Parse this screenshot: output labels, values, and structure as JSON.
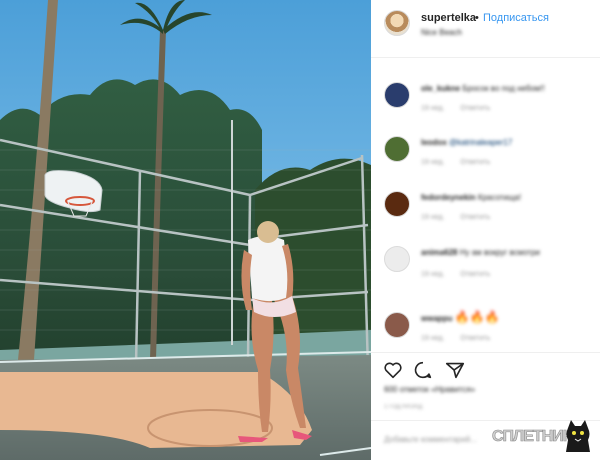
{
  "post": {
    "username": "supertelka",
    "separator": "•",
    "follow_label": "Подписаться",
    "location": "Nice Beach"
  },
  "comments": [
    {
      "user": "ole_kukne",
      "text": "Бросок во под небом!!",
      "time": "19 нед.",
      "reply": "Ответить",
      "avatar_color": "#2a3d6d"
    },
    {
      "user": "leodox",
      "text": "@katrinaleaper17",
      "time": "19 нед.",
      "reply": "Ответить",
      "avatar_color": "#4f6e33"
    },
    {
      "user": "fedordeynekin",
      "text": "Красотища!",
      "time": "19 нед.",
      "reply": "Ответить",
      "avatar_color": "#5a2a10"
    },
    {
      "user": "anima628",
      "text": "Ну ам вокруг всмотри",
      "time": "19 нед.",
      "reply": "Ответить",
      "avatar_color": "#ececec"
    },
    {
      "user": "wwappu",
      "text": "🔥🔥🔥",
      "time": "19 нед.",
      "reply": "Ответить",
      "avatar_color": "#8a5a4a"
    }
  ],
  "actions": {
    "like": "heart-icon",
    "comment": "comment-icon",
    "share": "share-icon"
  },
  "likes_text": "600 отметок «Нравится»",
  "time_ago": "1 ГОД НАЗАД",
  "add_comment_placeholder": "Добавьте комментарий...",
  "watermark": "СПЛЕТНИК"
}
